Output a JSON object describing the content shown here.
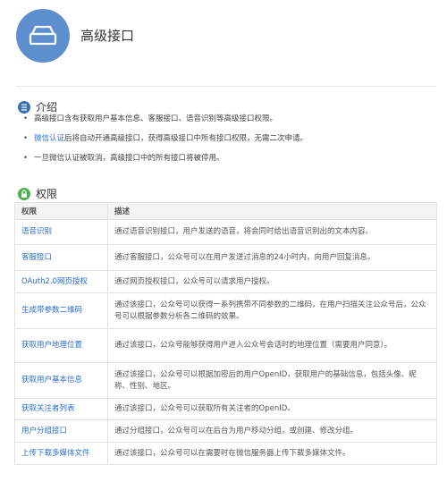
{
  "header": {
    "title": "高级接口"
  },
  "intro": {
    "title": "介绍",
    "items": [
      {
        "text": "高级接口含有获取用户基本信息、客服接口、语音识别等高级接口权限。"
      },
      {
        "link": "微信认证",
        "text": "后将自动开通高级接口，获得高级接口中所有接口权限，无需二次申请。"
      },
      {
        "text": "一旦微信认证被取消，高级接口中的所有接口将被停用。"
      }
    ]
  },
  "permissions": {
    "title": "权限",
    "headers": [
      "权限",
      "描述"
    ],
    "rows": [
      {
        "name": "语音识别",
        "desc": "通过语音识别接口，用户发送的语音，将会同时给出语音识别出的文本内容。"
      },
      {
        "name": "客服接口",
        "desc": "通过客服接口，公众号可以在用户发送过消息的24小时内，向用户回复消息。"
      },
      {
        "name": "OAuth2.0网页授权",
        "desc": "通过网页授权接口，公众号可以请求用户授权。"
      },
      {
        "name": "生成带参数二维码",
        "desc": "通过该接口，公众号可以获得一系列携带不同参数的二维码，在用户扫描关注公众号后，公众号可以根据参数分析各二维码的效果。"
      },
      {
        "name": "获取用户地理位置",
        "desc": "通过该接口，公众号能够获得用户进入公众号会话时的地理位置（需要用户同意）。"
      },
      {
        "name": "获取用户基本信息",
        "desc": "通过该接口，公众号可以根据加密后的用户OpenID，获取用户的基础信息，包括头像、昵称、性别、地区。"
      },
      {
        "name": "获取关注者列表",
        "desc": "通过该接口，公众号可以获取所有关注者的OpenID。"
      },
      {
        "name": "用户分组接口",
        "desc": "通过分组接口，公众号可以在后台为用户移动分组，或创建、修改分组。"
      },
      {
        "name": "上传下载多媒体文件",
        "desc": "通过该接口，公众号可以在需要时在微信服务器上传下载多媒体文件。"
      }
    ]
  },
  "icons": {
    "header": "tray-icon",
    "intro": "info-icon",
    "permissions": "lock-icon"
  },
  "colors": {
    "header_circle": "#5d8fcf",
    "link": "#2a6fd6",
    "lock_green": "#4caf50",
    "info_blue": "#3d70b2"
  }
}
